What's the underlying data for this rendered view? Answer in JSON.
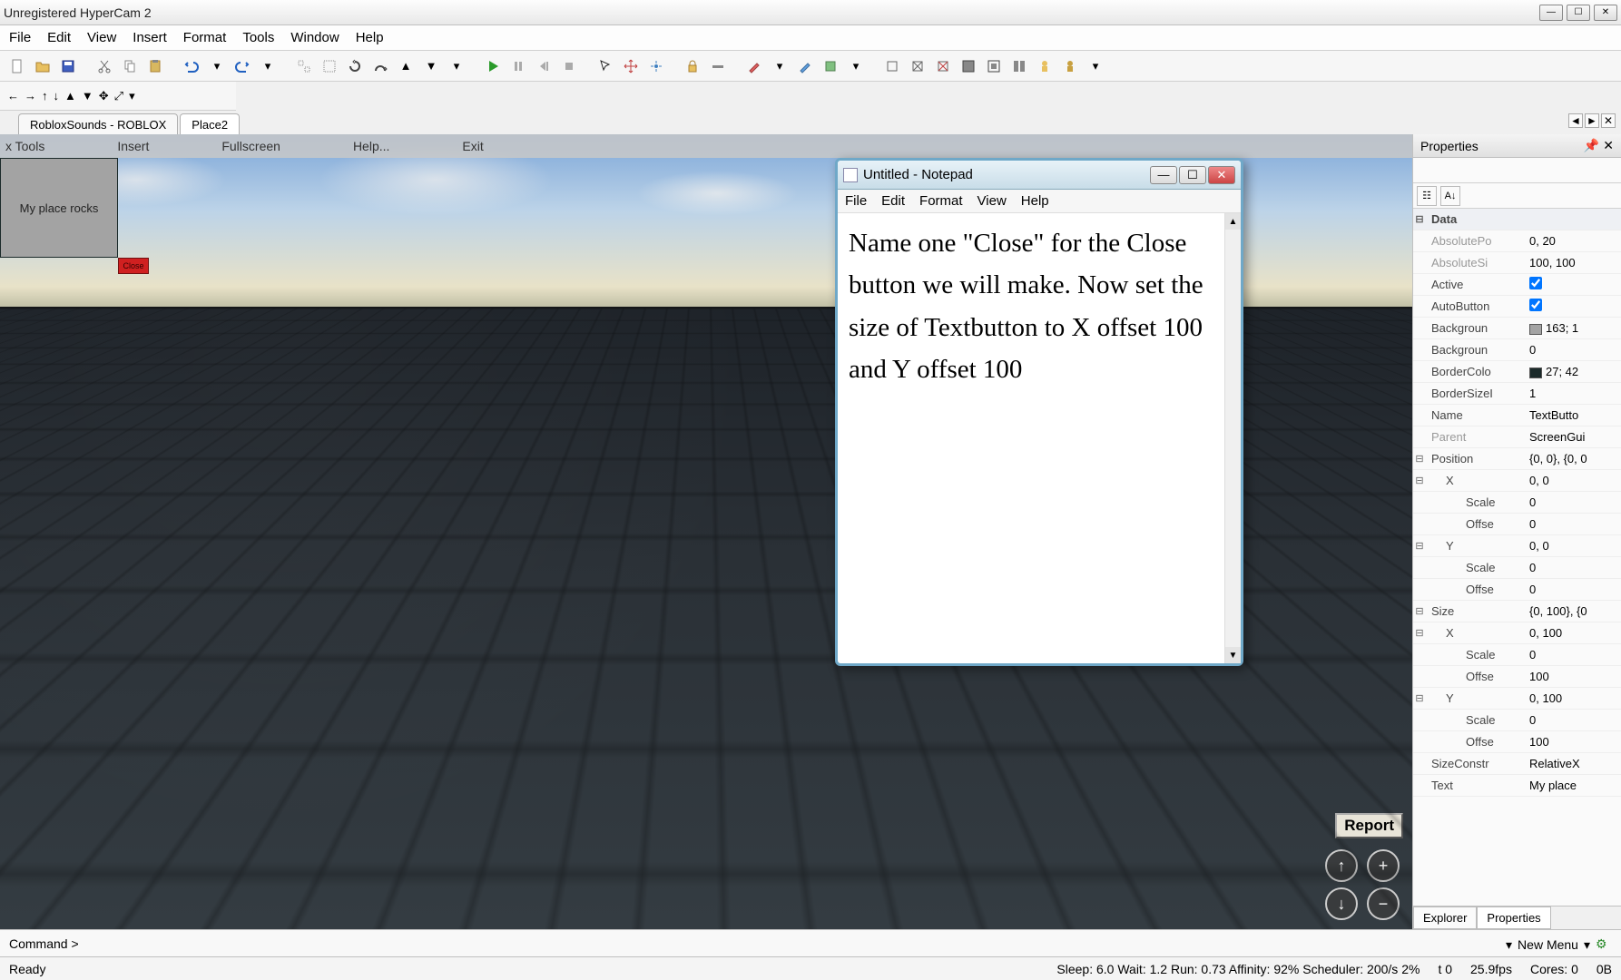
{
  "titlebar": {
    "title": "Unregistered HyperCam 2"
  },
  "menubar": [
    "File",
    "Edit",
    "View",
    "Insert",
    "Format",
    "Tools",
    "Window",
    "Help"
  ],
  "tabs": [
    {
      "label": "RobloxSounds - ROBLOX",
      "active": false
    },
    {
      "label": "Place2",
      "active": true
    }
  ],
  "game_toolbar": {
    "tools": "x Tools",
    "insert": "Insert",
    "fullscreen": "Fullscreen",
    "help": "Help...",
    "exit": "Exit"
  },
  "gui": {
    "textbutton_label": "My place rocks",
    "close_label": "Close"
  },
  "report_label": "Report",
  "notepad": {
    "title": "Untitled - Notepad",
    "menu": [
      "File",
      "Edit",
      "Format",
      "View",
      "Help"
    ],
    "body": "Name one \"Close\" for the Close button we will make. Now set  the size of Textbutton to X offset 100 and Y offset 100"
  },
  "properties": {
    "title": "Properties",
    "category": "Data",
    "rows": [
      {
        "k": "AbsolutePo",
        "v": "0, 20",
        "dim": true
      },
      {
        "k": "AbsoluteSi",
        "v": "100, 100",
        "dim": true
      },
      {
        "k": "Active",
        "v": "",
        "chk": true
      },
      {
        "k": "AutoButton",
        "v": "",
        "chk": true
      },
      {
        "k": "Backgroun",
        "v": "163; 1",
        "swatch": "#a3a3a3"
      },
      {
        "k": "Backgroun",
        "v": "0"
      },
      {
        "k": "BorderColo",
        "v": "27; 42",
        "swatch": "#1b2a2a"
      },
      {
        "k": "BorderSizeI",
        "v": "1"
      },
      {
        "k": "Name",
        "v": "TextButto"
      },
      {
        "k": "Parent",
        "v": "ScreenGui",
        "dim": true
      }
    ],
    "position": {
      "label": "Position",
      "val": "{0, 0}, {0, 0",
      "x": "0, 0",
      "xscale": "0",
      "xoffset": "0",
      "y": "0, 0",
      "yscale": "0",
      "yoffset": "0"
    },
    "size": {
      "label": "Size",
      "val": "{0, 100}, {0",
      "x": "0, 100",
      "xscale": "0",
      "xoffset": "100",
      "y": "0, 100",
      "yscale": "0",
      "yoffset": "100"
    },
    "sizeconstraint": {
      "k": "SizeConstr",
      "v": "RelativeX"
    },
    "text": {
      "k": "Text",
      "v": "My place"
    },
    "tabs": [
      "Explorer",
      "Properties"
    ]
  },
  "newmenu_label": "New Menu",
  "command_prompt": "Command >",
  "status": {
    "ready": "Ready",
    "perf": "Sleep: 6.0 Wait: 1.2 Run: 0.73 Affinity: 92% Scheduler: 200/s 2%",
    "t": "t 0",
    "fps": "25.9fps",
    "cores": "Cores: 0",
    "bytes": "0B"
  },
  "labels": {
    "x": "X",
    "y": "Y",
    "scale": "Scale",
    "offset": "Offse"
  }
}
